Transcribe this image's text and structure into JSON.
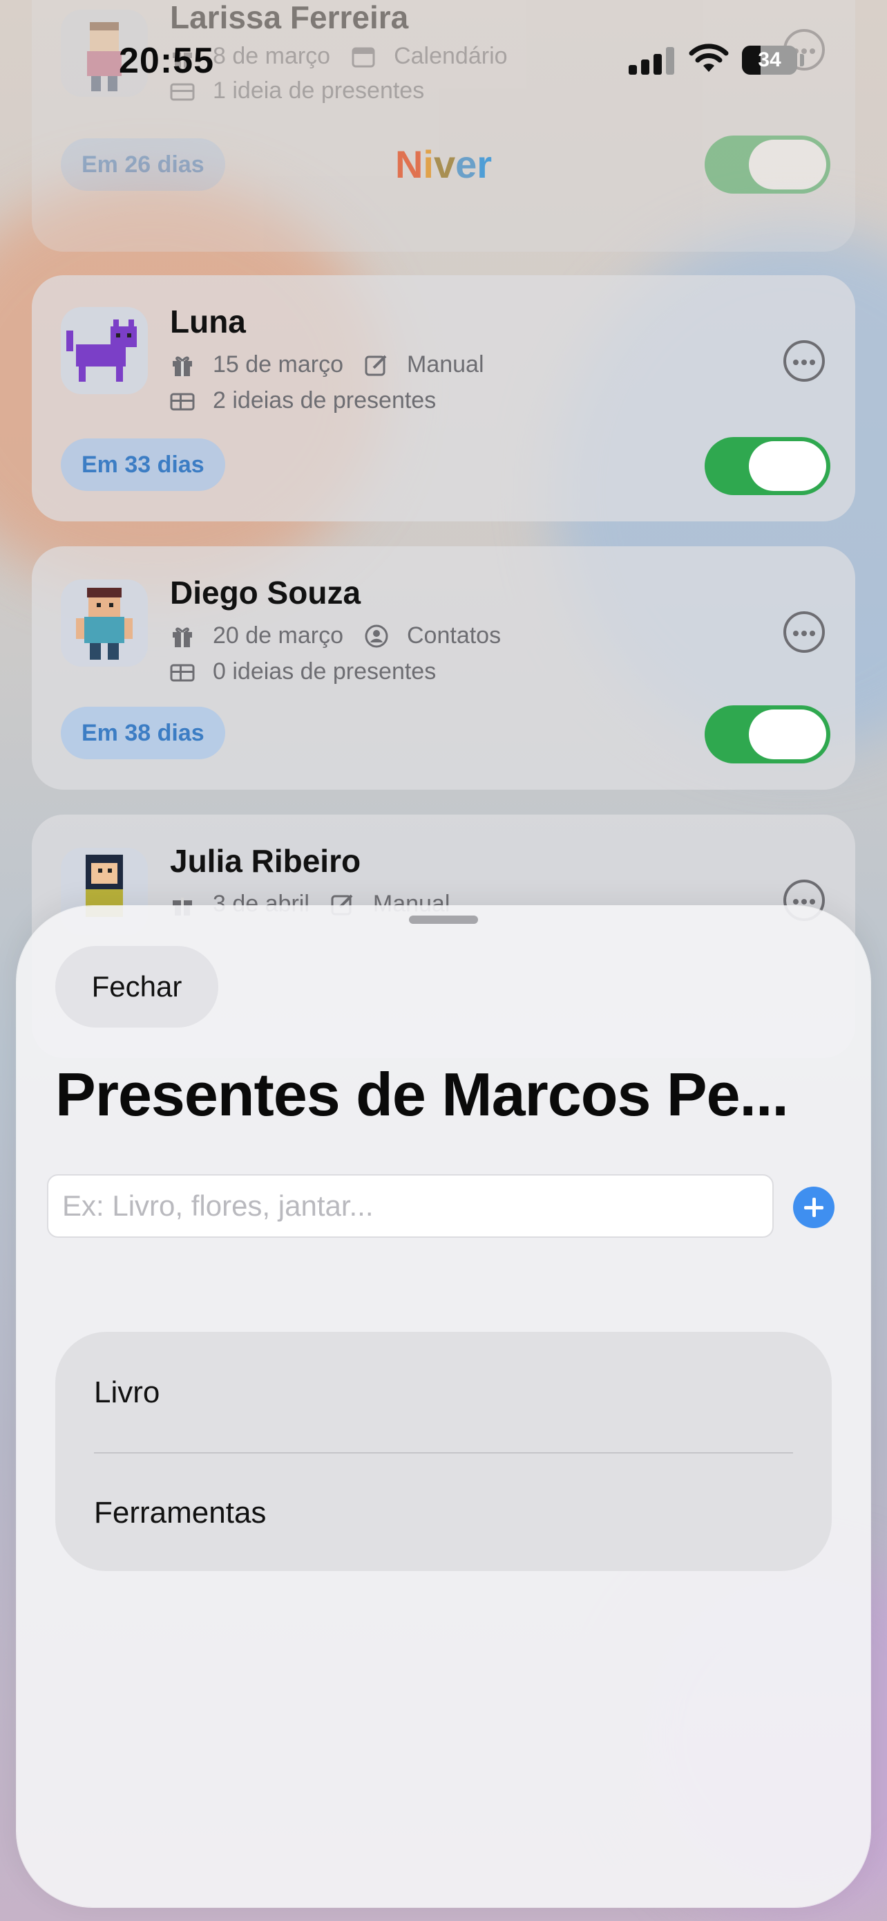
{
  "status_bar": {
    "time": "20:55",
    "battery_level": "34",
    "battery_fraction": 0.34
  },
  "app": {
    "title_letters": [
      "N",
      "i",
      "v",
      "e",
      "r"
    ]
  },
  "list": {
    "cards": [
      {
        "name": "Larissa Ferreira",
        "date": "8 de março",
        "source": "Calendário",
        "ideas": "1 ideia de presentes",
        "countdown": "Em 26 dias",
        "reminder_on": true,
        "avatar_icon": "person-avatar-icon"
      },
      {
        "name": "Luna",
        "date": "15 de março",
        "source": "Manual",
        "ideas": "2 ideias de presentes",
        "countdown": "Em 33 dias",
        "reminder_on": true,
        "avatar_icon": "cat-avatar-icon"
      },
      {
        "name": "Diego Souza",
        "date": "20 de março",
        "source": "Contatos",
        "ideas": "0 ideias de presentes",
        "countdown": "Em 38 dias",
        "reminder_on": true,
        "avatar_icon": "person-avatar-icon"
      },
      {
        "name": "Julia Ribeiro",
        "date": "3 de abril",
        "source": "Manual",
        "avatar_icon": "person-avatar-icon"
      }
    ]
  },
  "sheet": {
    "close_label": "Fechar",
    "title": "Presentes de Marcos Pe...",
    "input": {
      "value": "",
      "placeholder": "Ex: Livro, flores, jantar..."
    },
    "gifts": [
      "Livro",
      "Ferramentas"
    ]
  },
  "colors": {
    "accent": "#3f8ff0",
    "toggle_on": "#2fa84f",
    "badge_text": "#3c7dc4"
  }
}
